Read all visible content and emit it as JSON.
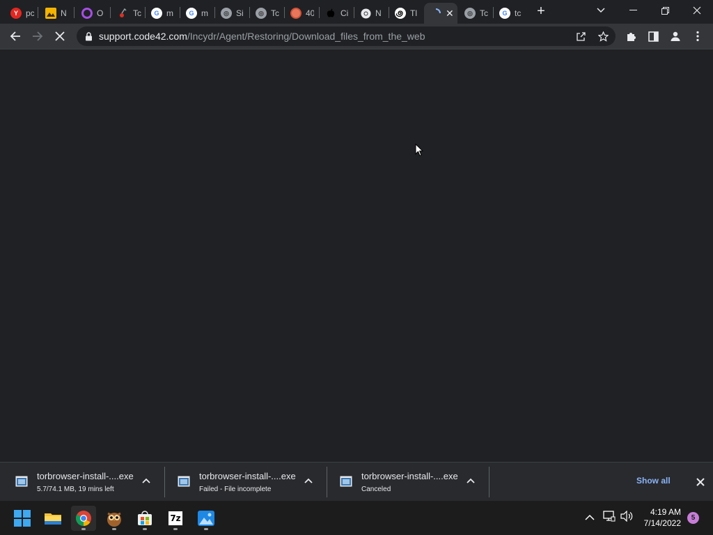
{
  "browser": {
    "tabs": [
      {
        "title": "pc",
        "icon": "yandex-icon"
      },
      {
        "title": "N",
        "icon": "image-icon"
      },
      {
        "title": "O",
        "icon": "opera-icon"
      },
      {
        "title": "Tc",
        "icon": "cherry-icon"
      },
      {
        "title": "m",
        "icon": "google-icon"
      },
      {
        "title": "m",
        "icon": "google-icon"
      },
      {
        "title": "Si",
        "icon": "globe-icon"
      },
      {
        "title": "Tc",
        "icon": "globe-icon"
      },
      {
        "title": "40",
        "icon": "target-icon"
      },
      {
        "title": "Ci",
        "icon": "apple-icon"
      },
      {
        "title": "N",
        "icon": "chrome-icon"
      },
      {
        "title": "Tl",
        "icon": "spiral-icon"
      },
      {
        "title": "",
        "icon": "loading-icon",
        "active": true
      },
      {
        "title": "Tc",
        "icon": "globe-icon"
      },
      {
        "title": "tc",
        "icon": "google-icon"
      }
    ],
    "new_tab_label": "+",
    "url_host": "support.code42.com",
    "url_path": "/Incydr/Agent/Restoring/Download_files_from_the_web"
  },
  "downloads": {
    "items": [
      {
        "name": "torbrowser-install-....exe",
        "status": "5.7/74.1 MB, 19 mins left"
      },
      {
        "name": "torbrowser-install-....exe",
        "status": "Failed - File incomplete"
      },
      {
        "name": "torbrowser-install-....exe",
        "status": "Canceled"
      }
    ],
    "show_all_label": "Show all"
  },
  "taskbar": {
    "apps": [
      "start-icon",
      "file-explorer-icon",
      "chrome-icon",
      "owl-icon",
      "store-icon",
      "7zip-icon",
      "photos-icon"
    ],
    "time": "4:19 AM",
    "date": "7/14/2022",
    "notification_count": "5",
    "seven_zip_label": "7z"
  }
}
